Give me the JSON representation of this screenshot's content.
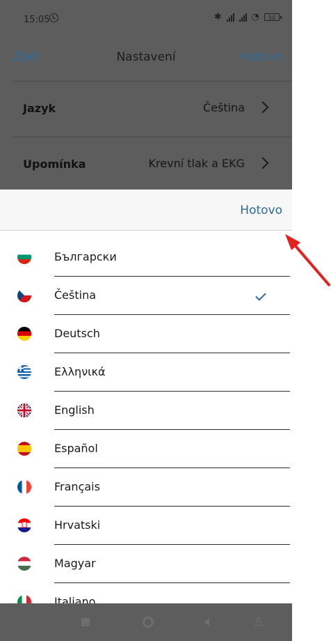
{
  "status_bar": {
    "time": "15:05",
    "battery": "50"
  },
  "navbar": {
    "back_label": "Zpět",
    "title": "Nastavení",
    "done_label": "Hotovo"
  },
  "settings": [
    {
      "label": "Jazyk",
      "value": "Čeština"
    },
    {
      "label": "Upomínka",
      "value": "Krevní tlak a EKG"
    }
  ],
  "picker": {
    "done_label": "Hotovo",
    "selected": "Čeština",
    "languages": [
      "Български",
      "Čeština",
      "Deutsch",
      "Ελληνικά",
      "English",
      "Español",
      "Français",
      "Hrvatski",
      "Magyar",
      "Italiano"
    ]
  },
  "colors": {
    "accent": "#2a6b99",
    "annotation_arrow": "#e3231b"
  }
}
